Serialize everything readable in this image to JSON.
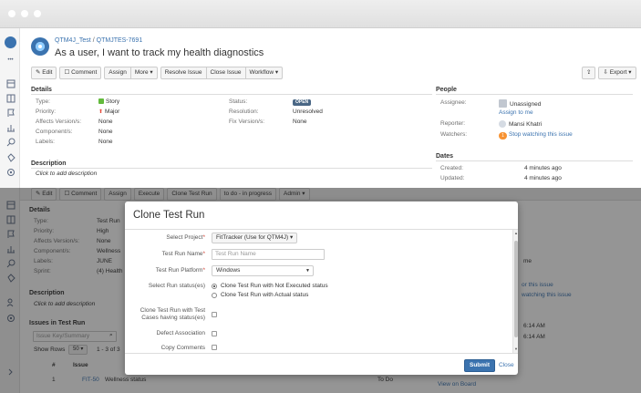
{
  "sidebar": {
    "icons": [
      "app-logo-icon",
      "more-icon",
      "board-icon",
      "layout-icon",
      "flag-icon",
      "chart-icon",
      "search-icon",
      "puzzle-icon",
      "gear-icon"
    ],
    "more_glyph": "•••"
  },
  "header": {
    "project": "QTM4J_Test",
    "issue_key": "QTMJTES-7691",
    "title": "As a user, I want to track my health diagnostics"
  },
  "toolbar": {
    "edit": "Edit",
    "comment": "Comment",
    "assign": "Assign",
    "more": "More ▾",
    "resolve": "Resolve Issue",
    "close": "Close Issue",
    "workflow": "Workflow ▾",
    "export": "Export ▾"
  },
  "details": {
    "heading": "Details",
    "type_label": "Type:",
    "type_value": "Story",
    "priority_label": "Priority:",
    "priority_value": "Major",
    "affects_label": "Affects Version/s:",
    "affects_value": "None",
    "components_label": "Component/s:",
    "components_value": "None",
    "labels_label": "Labels:",
    "labels_value": "None",
    "status_label": "Status:",
    "status_value": "OPEN",
    "resolution_label": "Resolution:",
    "resolution_value": "Unresolved",
    "fix_label": "Fix Version/s:",
    "fix_value": "None"
  },
  "description": {
    "heading": "Description",
    "placeholder": "Click to add description"
  },
  "people": {
    "heading": "People",
    "assignee_label": "Assignee:",
    "assignee_value": "Unassigned",
    "assign_me": "Assign to me",
    "reporter_label": "Reporter:",
    "reporter_value": "Mansi Khatri",
    "watchers_label": "Watchers:",
    "watchers_count": "1",
    "stop_watching": "Stop watching this issue"
  },
  "dates": {
    "heading": "Dates",
    "created_label": "Created:",
    "created_value": "4 minutes ago",
    "updated_label": "Updated:",
    "updated_value": "4 minutes ago"
  },
  "background": {
    "toolbar": [
      "Edit",
      "Comment",
      "Assign",
      "Execute",
      "Clone Test Run",
      "to do - in progress",
      "Admin ▾"
    ],
    "details_heading": "Details",
    "labels": [
      "Type:",
      "Priority:",
      "Affects Version/s:",
      "Component/s:",
      "Labels:",
      "Sprint:"
    ],
    "values": [
      "Test Run",
      "High",
      "None",
      "Wellness",
      "JUNE",
      "(4) Health"
    ],
    "description_heading": "Description",
    "description_placeholder": "Click to add description",
    "issues_heading": "Issues in Test Run",
    "issue_search_placeholder": "Issue Key/Summary",
    "show_rows_label": "Show Rows",
    "show_rows_value": "50 ▾",
    "range": "1 - 3 of 3",
    "col_num": "#",
    "col_issue": "Issue",
    "row_num": "1",
    "row_key": "FIT-50",
    "row_summary": "Wellness status",
    "row_status": "To Do",
    "right_text_1": "me",
    "right_text_2": "or this issue",
    "right_text_3": "watching this issue",
    "right_time_1": "6:14 AM",
    "right_time_2": "6:14 AM",
    "view_on_board": "View on Board"
  },
  "modal": {
    "title": "Clone Test Run",
    "project_label": "Select Project",
    "project_value": "FitTracker (Use for QTM4J) ▾",
    "name_label": "Test Run Name",
    "name_placeholder": "Test Run Name",
    "platform_label": "Test Run Platform",
    "platform_value": "Windows",
    "status_label": "Select Run status(es)",
    "status_opt1": "Clone Test Run with Not Executed status",
    "status_opt2": "Clone Test Run with Actual status",
    "clone_cases_label": "Clone Test Run with Test Cases having status(es)",
    "defect_label": "Defect Association",
    "comments_label": "Copy Comments",
    "submit": "Submit",
    "close": "Close"
  }
}
